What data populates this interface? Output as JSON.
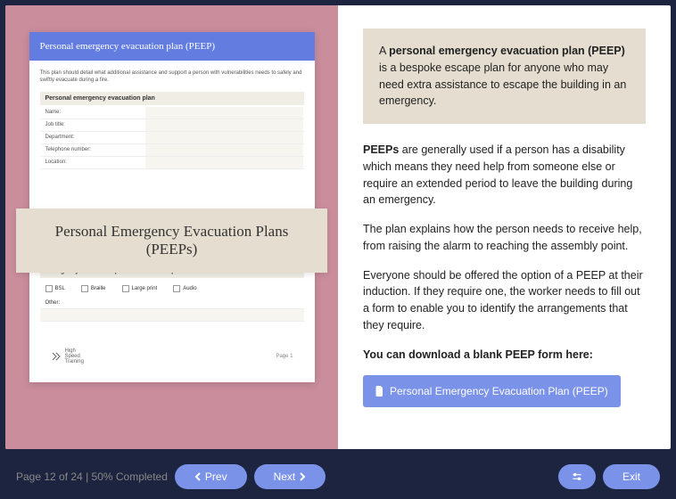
{
  "doc": {
    "header": "Personal emergency evacuation plan (PEEP)",
    "desc": "This plan should detail what additional assistance and support a person with vulnerabilities needs to safely and swiftly evacuate during a fire.",
    "section1": "Personal emergency evacuation plan",
    "fields": {
      "name": "Name:",
      "job": "Job title:",
      "dept": "Department:",
      "tel": "Telephone number:",
      "loc": "Location:"
    },
    "other": "Other:",
    "section2": "Emergency evacuation procedures will be provided to them in:",
    "checks": {
      "bsl": "BSL",
      "braille": "Braille",
      "large": "Large print",
      "audio": "Audio"
    },
    "logo": "High\nSpeed\nTraining",
    "page": "Page 1"
  },
  "overlay": "Personal Emergency Evacuation Plans (PEEPs)",
  "right": {
    "callout_pre": "A ",
    "callout_bold": "personal emergency evacuation plan (PEEP)",
    "callout_post": " is a bespoke escape plan for anyone who may need extra assistance to escape the building in an emergency.",
    "p1_bold": "PEEPs",
    "p1_rest": " are generally used if a person has a disability which means they need help from someone else or require an extended period to leave the building during an emergency.",
    "p2": "The plan explains how the person needs to receive help, from raising the alarm to reaching the assembly point.",
    "p3": "Everyone should be offered the option of a PEEP at their induction. If they require one, the worker needs to fill out a form to enable you to identify the arrangements that they require.",
    "p4": "You can download a blank PEEP form here:",
    "download": "Personal Emergency Evacuation Plan (PEEP)"
  },
  "footer": {
    "status": "Page 12 of 24 | 50% Completed",
    "prev": "Prev",
    "next": "Next",
    "exit": "Exit"
  }
}
